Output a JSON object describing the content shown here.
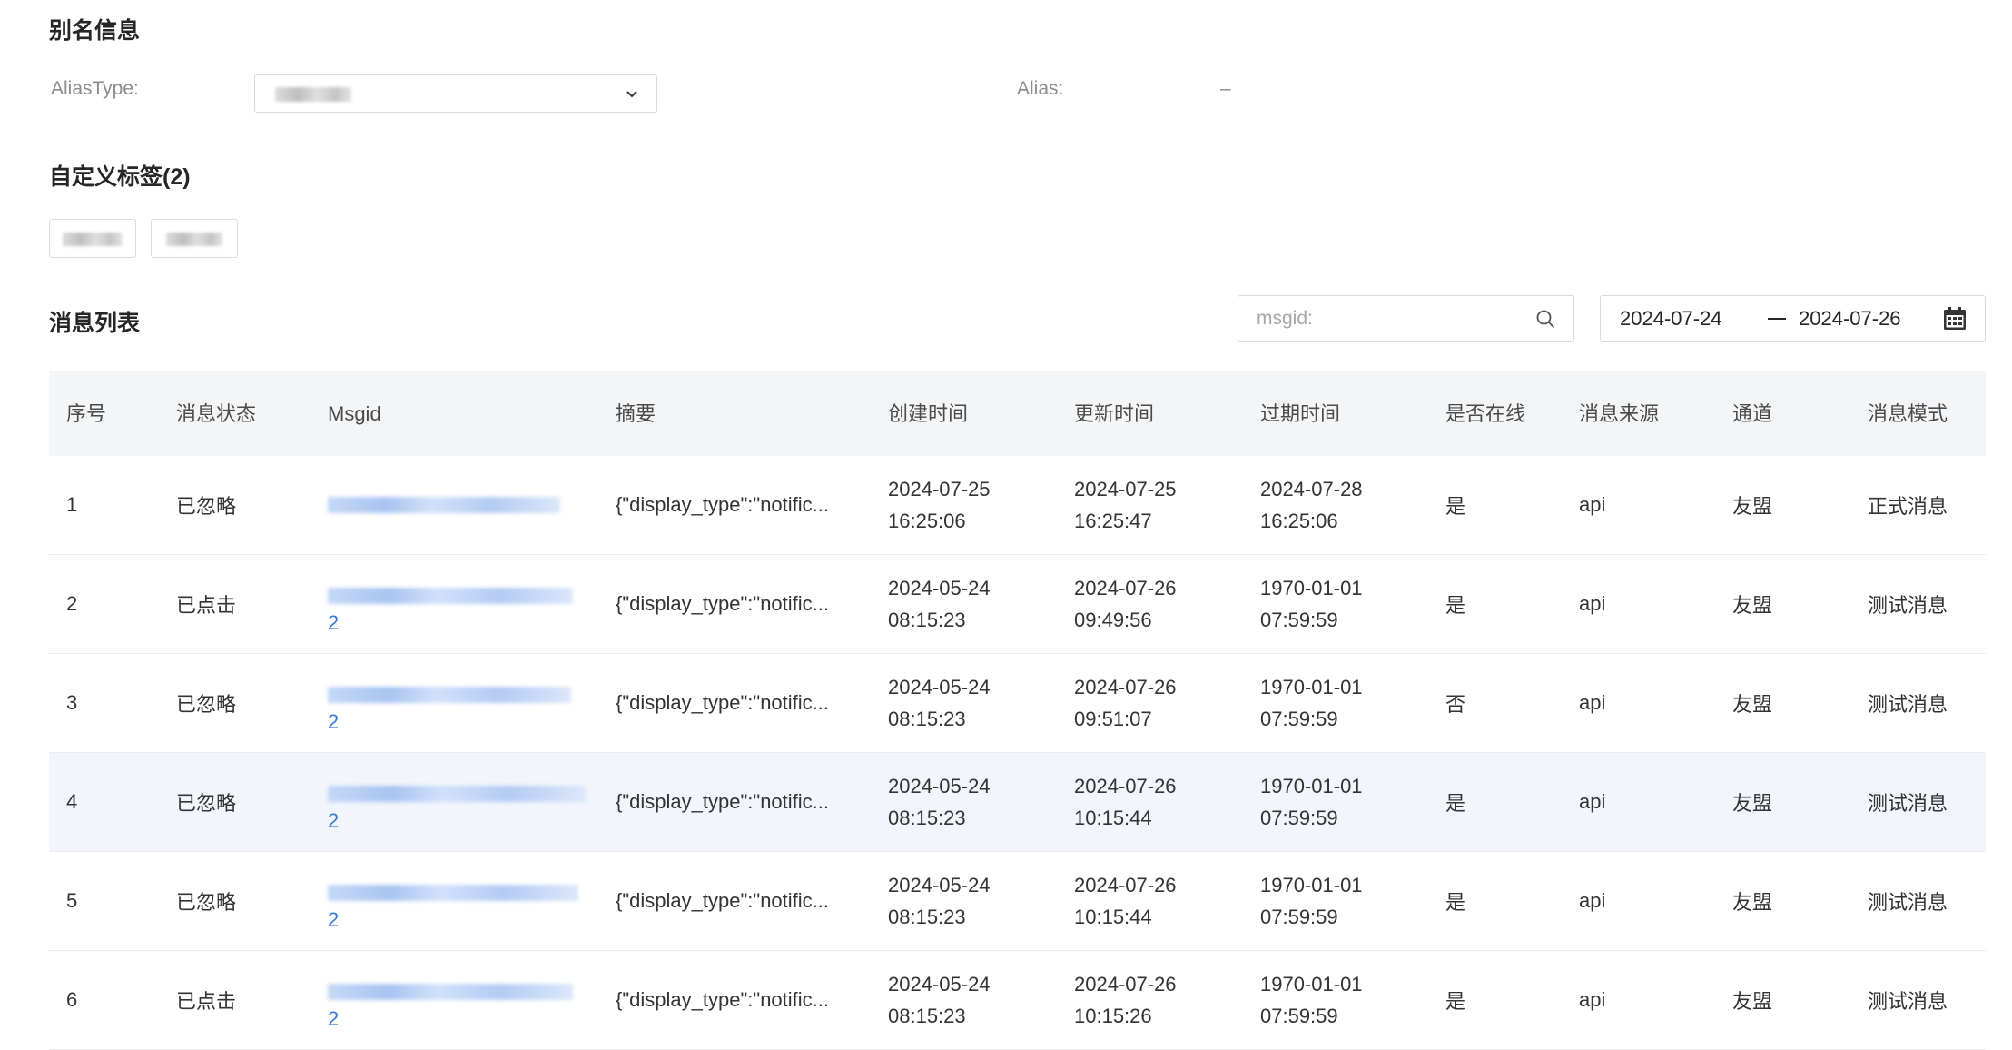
{
  "alias_section": {
    "title": "别名信息",
    "alias_type_label": "AliasType:",
    "alias_label": "Alias:",
    "alias_value": "–"
  },
  "tags_section": {
    "title": "自定义标签(2)"
  },
  "message_section": {
    "title": "消息列表",
    "search_placeholder": "msgid:",
    "date_start": "2024-07-24",
    "date_end": "2024-07-26"
  },
  "table": {
    "headers": [
      "序号",
      "消息状态",
      "Msgid",
      "摘要",
      "创建时间",
      "更新时间",
      "过期时间",
      "是否在线",
      "消息来源",
      "通道",
      "消息模式"
    ],
    "rows": [
      {
        "index": "1",
        "status": "已忽略",
        "msgid_suffix": "",
        "summary": "{\"display_type\":\"notific...",
        "created": [
          "2024-07-25",
          "16:25:06"
        ],
        "updated": [
          "2024-07-25",
          "16:25:47"
        ],
        "expires": [
          "2024-07-28",
          "16:25:06"
        ],
        "online": "是",
        "source": "api",
        "channel": "友盟",
        "mode": "正式消息"
      },
      {
        "index": "2",
        "status": "已点击",
        "msgid_suffix": "2",
        "summary": "{\"display_type\":\"notific...",
        "created": [
          "2024-05-24",
          "08:15:23"
        ],
        "updated": [
          "2024-07-26",
          "09:49:56"
        ],
        "expires": [
          "1970-01-01",
          "07:59:59"
        ],
        "online": "是",
        "source": "api",
        "channel": "友盟",
        "mode": "测试消息"
      },
      {
        "index": "3",
        "status": "已忽略",
        "msgid_suffix": "2",
        "summary": "{\"display_type\":\"notific...",
        "created": [
          "2024-05-24",
          "08:15:23"
        ],
        "updated": [
          "2024-07-26",
          "09:51:07"
        ],
        "expires": [
          "1970-01-01",
          "07:59:59"
        ],
        "online": "否",
        "source": "api",
        "channel": "友盟",
        "mode": "测试消息"
      },
      {
        "index": "4",
        "status": "已忽略",
        "msgid_suffix": "2",
        "summary": "{\"display_type\":\"notific...",
        "created": [
          "2024-05-24",
          "08:15:23"
        ],
        "updated": [
          "2024-07-26",
          "10:15:44"
        ],
        "expires": [
          "1970-01-01",
          "07:59:59"
        ],
        "online": "是",
        "source": "api",
        "channel": "友盟",
        "mode": "测试消息"
      },
      {
        "index": "5",
        "status": "已忽略",
        "msgid_suffix": "2",
        "summary": "{\"display_type\":\"notific...",
        "created": [
          "2024-05-24",
          "08:15:23"
        ],
        "updated": [
          "2024-07-26",
          "10:15:44"
        ],
        "expires": [
          "1970-01-01",
          "07:59:59"
        ],
        "online": "是",
        "source": "api",
        "channel": "友盟",
        "mode": "测试消息"
      },
      {
        "index": "6",
        "status": "已点击",
        "msgid_suffix": "2",
        "summary": "{\"display_type\":\"notific...",
        "created": [
          "2024-05-24",
          "08:15:23"
        ],
        "updated": [
          "2024-07-26",
          "10:15:26"
        ],
        "expires": [
          "1970-01-01",
          "07:59:59"
        ],
        "online": "是",
        "source": "api",
        "channel": "友盟",
        "mode": "测试消息"
      }
    ]
  },
  "icons": {
    "select": "chevron-down-icon",
    "search": "search-icon",
    "date": "calendar-icon"
  },
  "colors": {
    "link": "#3a7bd5",
    "header_bg": "#f4f5f7",
    "highlight_row": "#f2f6fc"
  }
}
